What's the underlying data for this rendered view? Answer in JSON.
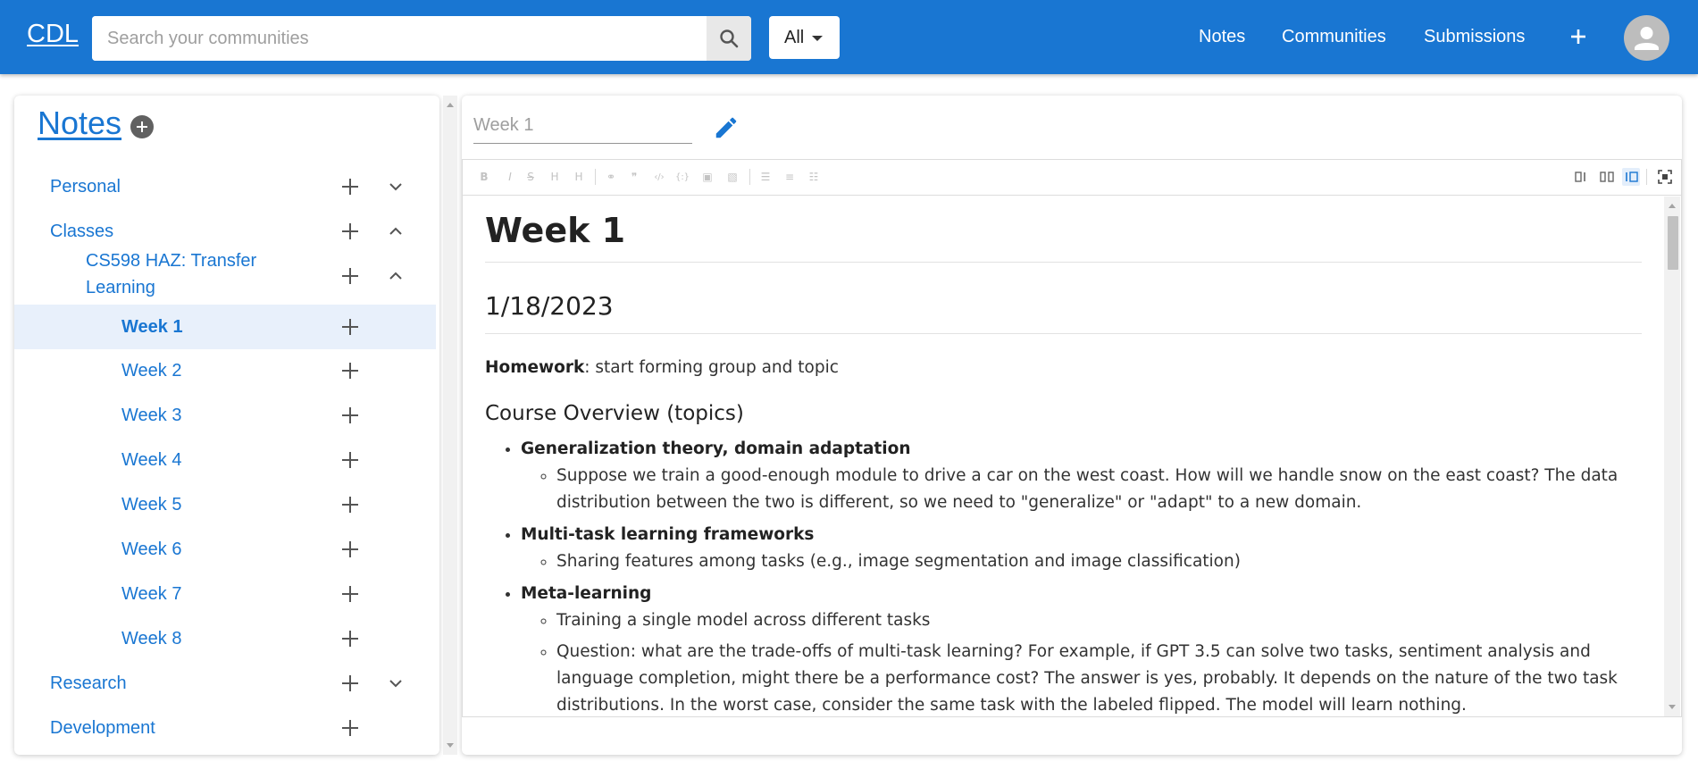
{
  "app": {
    "brand": "CDL",
    "accent_color": "#1976d2",
    "search": {
      "placeholder": "Search your communities",
      "value": "",
      "icon": "search-icon"
    },
    "filter": {
      "selected": "All"
    },
    "nav": [
      "Notes",
      "Communities",
      "Submissions"
    ]
  },
  "sidebar": {
    "title": "Notes",
    "tree": [
      {
        "label": "Personal",
        "level": 0,
        "expanded": false
      },
      {
        "label": "Classes",
        "level": 0,
        "expanded": true
      },
      {
        "label": "CS598 HAZ: Transfer Learning",
        "level": 1,
        "expanded": true
      },
      {
        "label": "Week 1",
        "level": 2,
        "selected": true
      },
      {
        "label": "Week 2",
        "level": 2
      },
      {
        "label": "Week 3",
        "level": 2
      },
      {
        "label": "Week 4",
        "level": 2
      },
      {
        "label": "Week 5",
        "level": 2
      },
      {
        "label": "Week 6",
        "level": 2
      },
      {
        "label": "Week 7",
        "level": 2
      },
      {
        "label": "Week 8",
        "level": 2
      },
      {
        "label": "Research",
        "level": 0,
        "expanded": false
      },
      {
        "label": "Development",
        "level": 0
      }
    ]
  },
  "editor": {
    "title_placeholder": "Week 1",
    "toolbar_icons": [
      "bold-icon",
      "italic-icon",
      "strikethrough-icon",
      "heading-icon",
      "heading-smaller-icon",
      "link-icon",
      "quote-icon",
      "code-icon",
      "code-block-icon",
      "comment-icon",
      "image-icon",
      "unordered-list-icon",
      "ordered-list-icon",
      "task-list-icon"
    ],
    "view_icons": [
      "edit-mode-icon",
      "split-mode-icon",
      "preview-mode-icon",
      "fullscreen-icon"
    ],
    "content": {
      "h1": "Week 1",
      "date": "1/18/2023",
      "homework_label": "Homework",
      "homework_text": ": start forming group and topic",
      "overview_heading": "Course Overview (topics)",
      "topics": [
        {
          "name": "Generalization theory, domain adaptation",
          "items": [
            "Suppose we train a good-enough module to drive a car on the west coast. How will we handle snow on the east coast? The data distribution between the two is different, so we need to \"generalize\" or \"adapt\" to a new domain."
          ]
        },
        {
          "name": "Multi-task learning frameworks",
          "items": [
            "Sharing features among tasks (e.g., image segmentation and image classification)"
          ]
        },
        {
          "name": "Meta-learning",
          "items": [
            "Training a single model across different tasks",
            "Question: what are the trade-offs of multi-task learning? For example, if GPT 3.5 can solve two tasks, sentiment analysis and language completion, might there be a performance cost? The answer is yes, probably. It depends on the nature of the two task distributions. In the worst case, consider the same task with the labeled flipped. The model will learn nothing."
          ]
        }
      ]
    }
  }
}
